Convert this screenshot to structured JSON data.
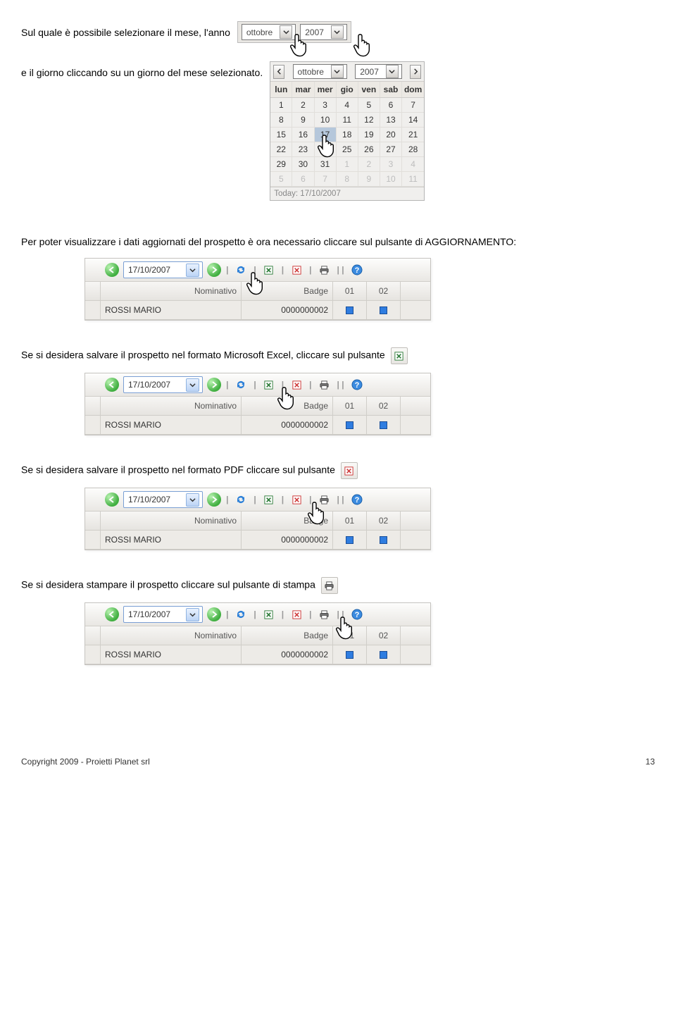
{
  "intro": {
    "line1": "Sul quale è possibile selezionare il mese, l'anno",
    "line2": "e il giorno cliccando su un giorno del mese selezionato."
  },
  "month_year": {
    "month": "ottobre",
    "year": "2007"
  },
  "calendar": {
    "month": "ottobre",
    "year": "2007",
    "weekdays": [
      "lun",
      "mar",
      "mer",
      "gio",
      "ven",
      "sab",
      "dom"
    ],
    "rows": [
      [
        {
          "n": 1
        },
        {
          "n": 2
        },
        {
          "n": 3
        },
        {
          "n": 4
        },
        {
          "n": 5
        },
        {
          "n": 6
        },
        {
          "n": 7
        }
      ],
      [
        {
          "n": 8
        },
        {
          "n": 9
        },
        {
          "n": 10
        },
        {
          "n": 11
        },
        {
          "n": 12
        },
        {
          "n": 13
        },
        {
          "n": 14
        }
      ],
      [
        {
          "n": 15
        },
        {
          "n": 16
        },
        {
          "n": 17,
          "sel": true
        },
        {
          "n": 18
        },
        {
          "n": 19
        },
        {
          "n": 20
        },
        {
          "n": 21
        }
      ],
      [
        {
          "n": 22
        },
        {
          "n": 23
        },
        {
          "n": 24
        },
        {
          "n": 25
        },
        {
          "n": 26
        },
        {
          "n": 27
        },
        {
          "n": 28
        }
      ],
      [
        {
          "n": 29
        },
        {
          "n": 30
        },
        {
          "n": 31
        },
        {
          "n": 1,
          "dim": true
        },
        {
          "n": 2,
          "dim": true
        },
        {
          "n": 3,
          "dim": true
        },
        {
          "n": 4,
          "dim": true
        }
      ],
      [
        {
          "n": 5,
          "dim": true
        },
        {
          "n": 6,
          "dim": true
        },
        {
          "n": 7,
          "dim": true
        },
        {
          "n": 8,
          "dim": true
        },
        {
          "n": 9,
          "dim": true
        },
        {
          "n": 10,
          "dim": true
        },
        {
          "n": 11,
          "dim": true
        }
      ]
    ],
    "today": "Today: 17/10/2007"
  },
  "paragraphs": {
    "after_cal": "Per poter visualizzare i dati aggiornati del prospetto è ora necessario cliccare sul pulsante di AGGIORNAMENTO:",
    "excel": "Se si desidera salvare il prospetto nel formato Microsoft Excel, cliccare sul pulsante",
    "pdf": "Se si desidera salvare il prospetto nel formato PDF cliccare sul pulsante",
    "print": "Se si desidera stampare il prospetto cliccare sul pulsante di stampa"
  },
  "toolbar": {
    "date": "17/10/2007",
    "headers": {
      "nominativo": "Nominativo",
      "badge": "Badge",
      "c01": "01",
      "c02": "02"
    },
    "data": {
      "name": "ROSSI MARIO",
      "badge": "0000000002"
    }
  },
  "footer": {
    "copyright": "Copyright 2009 - Proietti Planet srl",
    "page": "13"
  }
}
